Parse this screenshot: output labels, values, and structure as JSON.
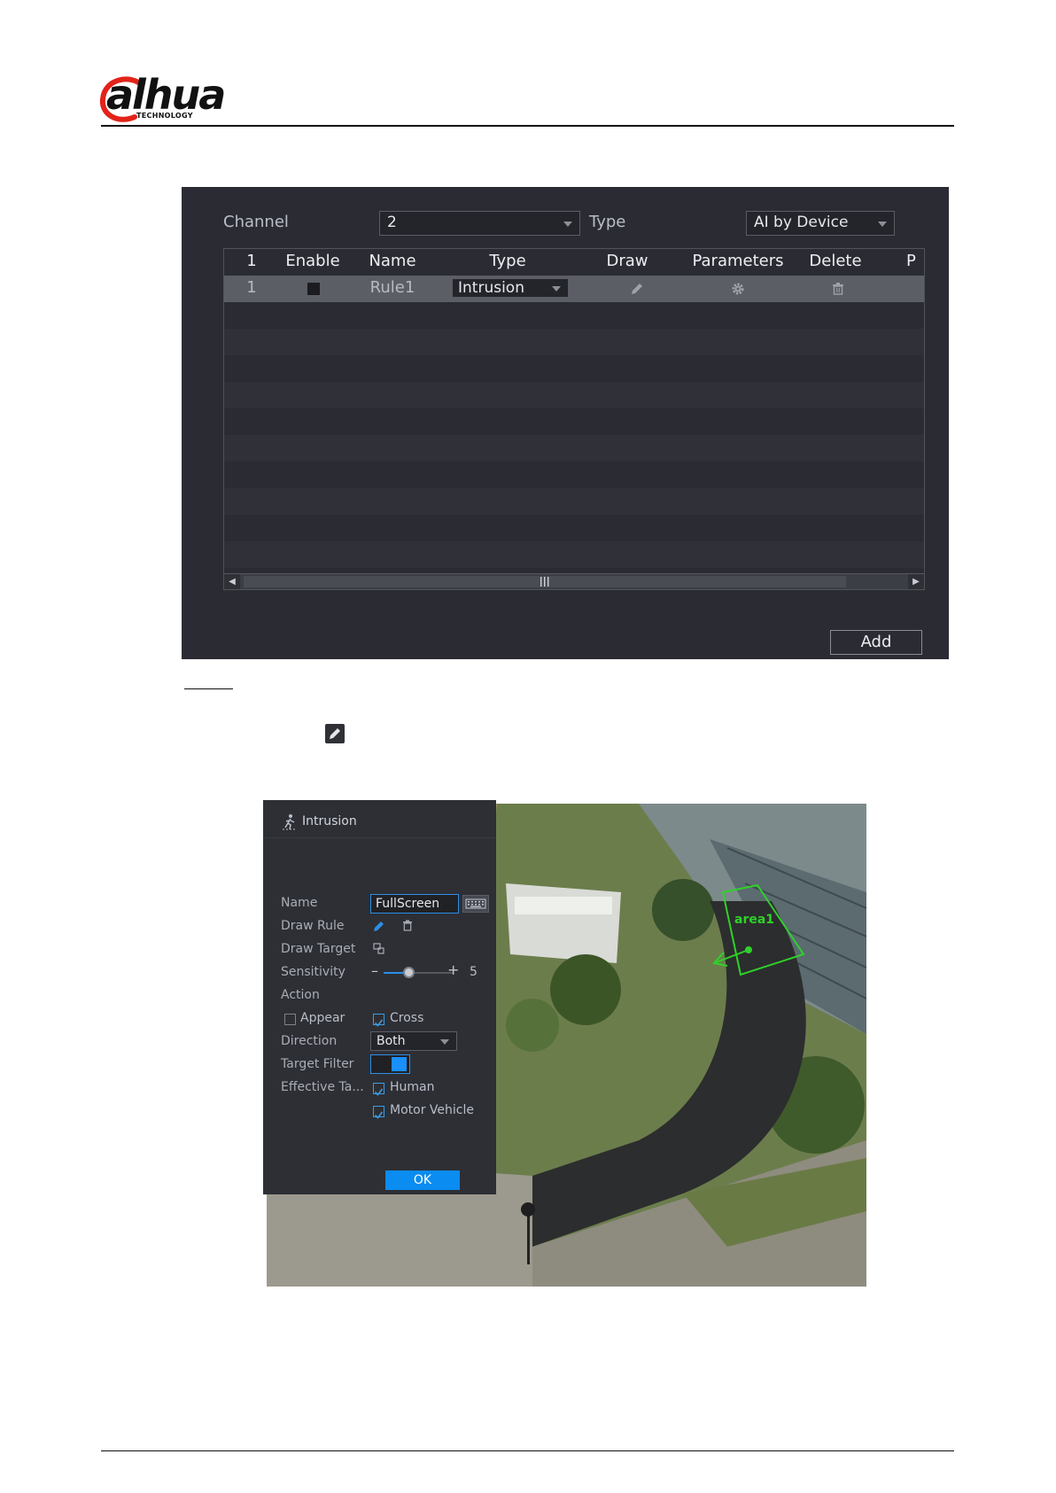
{
  "header": {
    "logo_text": "alhua",
    "logo_sub": "TECHNOLOGY"
  },
  "rules_screen": {
    "channel_label": "Channel",
    "channel_value": "2",
    "type_label": "Type",
    "type_value": "AI by Device",
    "columns": [
      "1",
      "Enable",
      "Name",
      "Type",
      "Draw",
      "Parameters",
      "Delete",
      "P"
    ],
    "rows": [
      {
        "index": "1",
        "name": "Rule1",
        "type": "Intrusion"
      }
    ],
    "add_label": "Add"
  },
  "intrusion_screen": {
    "title": "Intrusion",
    "labels": {
      "name": "Name",
      "draw_rule": "Draw Rule",
      "draw_target": "Draw Target",
      "sensitivity": "Sensitivity",
      "action": "Action",
      "direction": "Direction",
      "target_filter": "Target Filter",
      "effective_target": "Effective Ta..."
    },
    "name_value": "FullScreen",
    "sensitivity_value": "5",
    "appear_label": "Appear",
    "appear_checked": false,
    "cross_label": "Cross",
    "cross_checked": true,
    "direction_value": "Both",
    "target_filter_on": true,
    "human_label": "Human",
    "human_checked": true,
    "motor_vehicle_label": "Motor Vehicle",
    "motor_vehicle_checked": true,
    "ok_label": "OK",
    "area_label": "area1"
  },
  "colors": {
    "panel_bg": "#2d2f35",
    "accent_blue": "#0a8cf0",
    "area_green": "#2fd12a",
    "brand_red": "#e2231a"
  }
}
